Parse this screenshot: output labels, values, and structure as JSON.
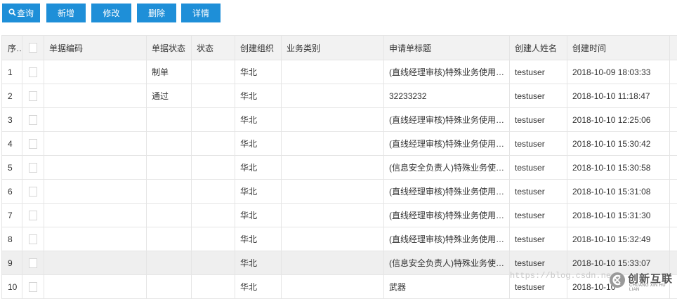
{
  "toolbar": {
    "query_label": "查询",
    "add_label": "新增",
    "edit_label": "修改",
    "delete_label": "删除",
    "detail_label": "详情"
  },
  "table": {
    "headers": {
      "seq": "序号",
      "code": "单据编码",
      "doc_status": "单据状态",
      "status": "状态",
      "org": "创建组织",
      "biz_type": "业务类别",
      "title": "申请单标题",
      "creator": "创建人姓名",
      "created_time": "创建时间"
    },
    "rows": [
      {
        "seq": "1",
        "code": "",
        "doc_status": "制单",
        "status": "",
        "org": "华北",
        "biz_type": "",
        "title": "(直线经理审核)特殊业务使用报备-提...",
        "creator": "testuser",
        "created_time": "2018-10-09 18:03:33"
      },
      {
        "seq": "2",
        "code": "",
        "doc_status": "通过",
        "status": "",
        "org": "华北",
        "biz_type": "",
        "title": "32233232",
        "creator": "testuser",
        "created_time": "2018-10-10 11:18:47"
      },
      {
        "seq": "3",
        "code": "",
        "doc_status": "",
        "status": "",
        "org": "华北",
        "biz_type": "",
        "title": "(直线经理审核)特殊业务使用报备-提...",
        "creator": "testuser",
        "created_time": "2018-10-10 12:25:06"
      },
      {
        "seq": "4",
        "code": "",
        "doc_status": "",
        "status": "",
        "org": "华北",
        "biz_type": "",
        "title": "(直线经理审核)特殊业务使用报备-提...",
        "creator": "testuser",
        "created_time": "2018-10-10 15:30:42"
      },
      {
        "seq": "5",
        "code": "",
        "doc_status": "",
        "status": "",
        "org": "华北",
        "biz_type": "",
        "title": "(信息安全负责人)特殊业务使用报备-...",
        "creator": "testuser",
        "created_time": "2018-10-10 15:30:58"
      },
      {
        "seq": "6",
        "code": "",
        "doc_status": "",
        "status": "",
        "org": "华北",
        "biz_type": "",
        "title": "(直线经理审核)特殊业务使用报备-提...",
        "creator": "testuser",
        "created_time": "2018-10-10 15:31:08"
      },
      {
        "seq": "7",
        "code": "",
        "doc_status": "",
        "status": "",
        "org": "华北",
        "biz_type": "",
        "title": "(直线经理审核)特殊业务使用报备-提...",
        "creator": "testuser",
        "created_time": "2018-10-10 15:31:30"
      },
      {
        "seq": "8",
        "code": "",
        "doc_status": "",
        "status": "",
        "org": "华北",
        "biz_type": "",
        "title": "(直线经理审核)特殊业务使用报备-提...",
        "creator": "testuser",
        "created_time": "2018-10-10 15:32:49"
      },
      {
        "seq": "9",
        "code": "",
        "doc_status": "",
        "status": "",
        "org": "华北",
        "biz_type": "",
        "title": "(信息安全负责人)特殊业务使用报备-...",
        "creator": "testuser",
        "created_time": "2018-10-10 15:33:07"
      },
      {
        "seq": "10",
        "code": "",
        "doc_status": "",
        "status": "",
        "org": "华北",
        "biz_type": "",
        "title": "武器",
        "creator": "testuser",
        "created_time": "2018-10-10"
      }
    ],
    "highlighted_row": 9
  },
  "watermark": {
    "url": "https://blog.csdn.ne",
    "logo_text": "创新互联",
    "logo_sub": "CHUANG XIN HU LIAN"
  },
  "colors": {
    "button_bg": "#1e8fd8",
    "header_bg": "#f2f2f2",
    "highlight_row_bg": "#efefef"
  },
  "icons": {
    "query": "search-icon"
  }
}
